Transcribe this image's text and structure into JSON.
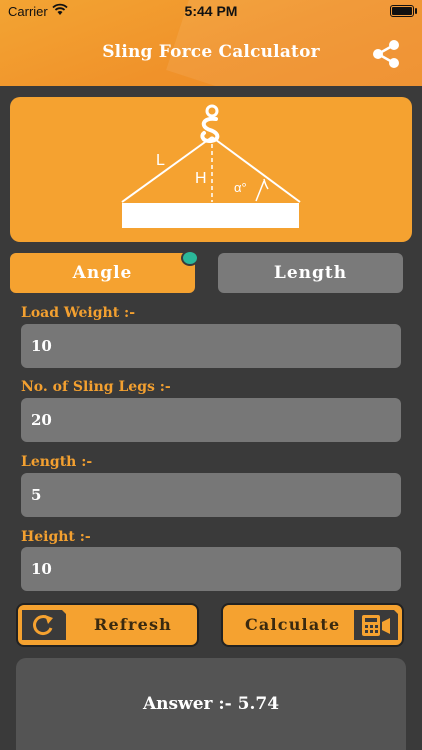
{
  "status": {
    "carrier": "Carrier",
    "time": "5:44 PM"
  },
  "header": {
    "title": "Sling Force Calculator"
  },
  "diagram": {
    "length_label": "L",
    "height_label": "H",
    "angle_label": "α°"
  },
  "tabs": [
    {
      "label": "Angle",
      "selected": true
    },
    {
      "label": "Length",
      "selected": false
    }
  ],
  "fields": {
    "load_weight": {
      "label": "Load Weight :-",
      "value": "10"
    },
    "sling_legs": {
      "label": "No. of Sling Legs :-",
      "value": "20"
    },
    "length": {
      "label": "Length :-",
      "value": "5"
    },
    "height": {
      "label": "Height :-",
      "value": "10"
    }
  },
  "buttons": {
    "refresh": "Refresh",
    "calculate": "Calculate"
  },
  "result": {
    "answer": "Answer :- 5.74"
  },
  "colors": {
    "accent": "#f5a230",
    "field": "#777777",
    "background": "#3a3a3a",
    "indicator": "#2bb89a"
  },
  "icons": [
    "wifi-icon",
    "battery-icon",
    "share-icon",
    "hook-icon",
    "refresh-icon",
    "calculator-icon"
  ]
}
